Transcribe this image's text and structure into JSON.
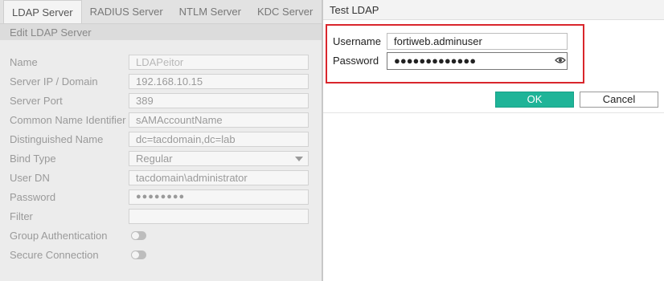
{
  "tabs": [
    {
      "label": "LDAP Server",
      "active": true
    },
    {
      "label": "RADIUS Server",
      "active": false
    },
    {
      "label": "NTLM Server",
      "active": false
    },
    {
      "label": "KDC Server",
      "active": false
    }
  ],
  "edit_panel": {
    "heading": "Edit LDAP Server",
    "fields": [
      {
        "label": "Name",
        "value": "LDAPeitor"
      },
      {
        "label": "Server IP / Domain",
        "value": "192.168.10.15"
      },
      {
        "label": "Server Port",
        "value": "389"
      },
      {
        "label": "Common Name Identifier",
        "value": "sAMAccountName"
      },
      {
        "label": "Distinguished Name",
        "value": "dc=tacdomain,dc=lab"
      },
      {
        "label": "Bind Type",
        "value": "Regular"
      },
      {
        "label": "User DN",
        "value": "tacdomain\\administrator"
      },
      {
        "label": "Password",
        "value": "●●●●●●●●"
      },
      {
        "label": "Filter",
        "value": ""
      },
      {
        "label": "Group Authentication",
        "enabled": false
      },
      {
        "label": "Secure Connection",
        "enabled": false
      }
    ]
  },
  "dialog": {
    "title": "Test LDAP",
    "username_label": "Username",
    "username_value": "fortiweb.adminuser",
    "password_label": "Password",
    "password_value": "●●●●●●●●●●●●●",
    "ok_label": "OK",
    "cancel_label": "Cancel"
  },
  "colors": {
    "highlight_border": "#d9262c",
    "ok_button": "#1fb498"
  },
  "icons": {
    "show_password": "eye-icon",
    "bind_type_dropdown": "chevron-down-icon"
  }
}
